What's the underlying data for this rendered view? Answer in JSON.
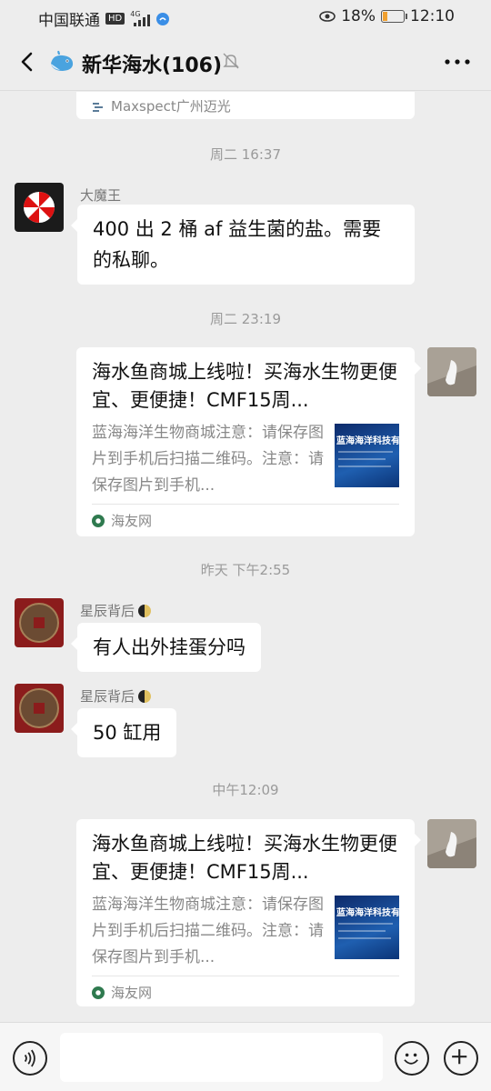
{
  "status_bar": {
    "carrier": "中国联通",
    "network_badge": "HD",
    "network_type": "4G",
    "battery_percent": "18%",
    "time": "12:10"
  },
  "header": {
    "title": "新华海水(106)"
  },
  "chat": {
    "previous_card_source": "Maxspect广州迈光",
    "messages": [
      {
        "type": "timestamp",
        "text": "周二 16:37"
      },
      {
        "type": "text",
        "sender": "大魔王",
        "text": "400 出 2 桶 af 益生菌的盐。需要的私聊。",
        "side": "left"
      },
      {
        "type": "timestamp",
        "text": "周二 23:19"
      },
      {
        "type": "link_card",
        "side": "right",
        "title": "海水鱼商城上线啦！买海水生物更便宜、更便捷！CMF15周...",
        "description": "蓝海海洋生物商城注意：请保存图片到手机后扫描二维码。注意：请保存图片到手机...",
        "thumb_text": "蓝海海洋科技有",
        "source": "海友网"
      },
      {
        "type": "timestamp",
        "text": "昨天 下午2:55"
      },
      {
        "type": "text",
        "sender": "星辰背后",
        "text": "有人出外挂蛋分吗",
        "side": "left"
      },
      {
        "type": "text",
        "sender": "星辰背后",
        "text": "50 缸用",
        "side": "left"
      },
      {
        "type": "timestamp",
        "text": "中午12:09"
      },
      {
        "type": "link_card",
        "side": "right",
        "title": "海水鱼商城上线啦！买海水生物更便宜、更便捷！CMF15周...",
        "description": "蓝海海洋生物商城注意：请保存图片到手机后扫描二维码。注意：请保存图片到手机...",
        "thumb_text": "蓝海海洋科技有",
        "source": "海友网"
      }
    ]
  },
  "icons": {
    "back": "chevron-left-icon",
    "group_avatar": "whale-icon",
    "mute": "bell-muted-icon",
    "more": "more-dots-icon",
    "voice": "voice-icon",
    "emoji": "emoji-icon",
    "plus": "plus-icon"
  },
  "colors": {
    "background": "#ededed",
    "bubble": "#ffffff",
    "meta_text": "#9a9a9a"
  }
}
